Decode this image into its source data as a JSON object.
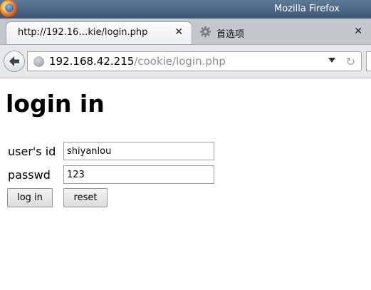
{
  "window": {
    "title": "Mozilla Firefox"
  },
  "tabs": [
    {
      "label": "http://192.16…kie/login.php",
      "active": true
    },
    {
      "label": "首选项",
      "active": false,
      "icon": "gear-icon"
    }
  ],
  "navbar": {
    "url_host": "192.168.42.215",
    "url_path": "/cookie/login.php"
  },
  "page": {
    "heading": "login in",
    "form": {
      "user_label": "user's id",
      "user_value": "shiyanlou",
      "pass_label": "passwd",
      "pass_value": "123",
      "login_button": "log in",
      "reset_button": "reset"
    }
  },
  "icons": {
    "browser_logo": "firefox-logo-icon",
    "back": "back-arrow-icon",
    "site": "site-identity-icon",
    "dropdown": "url-history-dropdown-icon",
    "reload": "reload-icon",
    "close": "tab-close-icon"
  }
}
